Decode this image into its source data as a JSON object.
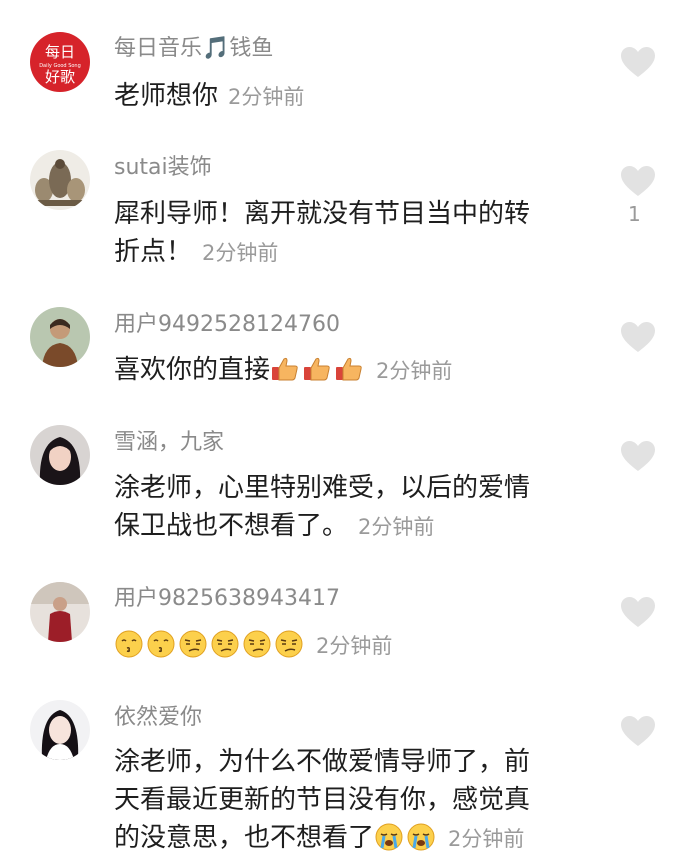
{
  "comments": [
    {
      "username": "每日音乐🎵钱鱼",
      "avatar_text_top": "每日",
      "avatar_text_bottom": "好歌",
      "avatar_text_small": "Daily Good Song",
      "text": "老师想你",
      "time": "2分钟前",
      "likes": ""
    },
    {
      "username": "sutai装饰",
      "text": "犀利导师！离开就没有节目当中的转折点！",
      "text_line1": "犀利导师！离开就没有节目当中的转",
      "text_line2": "折点！",
      "time": "2分钟前",
      "likes": "1"
    },
    {
      "username": "用户9492528124760",
      "text": "喜欢你的直接",
      "emojis": [
        "thumbs-up",
        "thumbs-up",
        "thumbs-up"
      ],
      "time": "2分钟前",
      "likes": ""
    },
    {
      "username": "雪涵，九家",
      "text_line1": "涂老师，心里特别难受，以后的爱情",
      "text_line2": "保卫战也不想看了。",
      "time": "2分钟前",
      "likes": ""
    },
    {
      "username": "用户9825638943417",
      "text": "",
      "emojis": [
        "kissing-face",
        "kissing-face",
        "smirk-face",
        "smirk-face",
        "smirk-face",
        "smirk-face"
      ],
      "time": "2分钟前",
      "likes": ""
    },
    {
      "username": "依然爱你",
      "text_line1": "涂老师，为什么不做爱情导师了，前",
      "text_line2": "天看最近更新的节目没有你，感觉真",
      "text_line3": "的没意思，也不想看了",
      "emojis": [
        "crying-face",
        "crying-face"
      ],
      "time": "2分钟前",
      "likes": ""
    }
  ],
  "colors": {
    "username": "#8a8a8a",
    "text": "#1e1e1e",
    "time": "#9a9a9a",
    "heart": "#e2e2e2",
    "avatar_red": "#d6232a"
  },
  "icons": {
    "like": "heart-icon"
  }
}
